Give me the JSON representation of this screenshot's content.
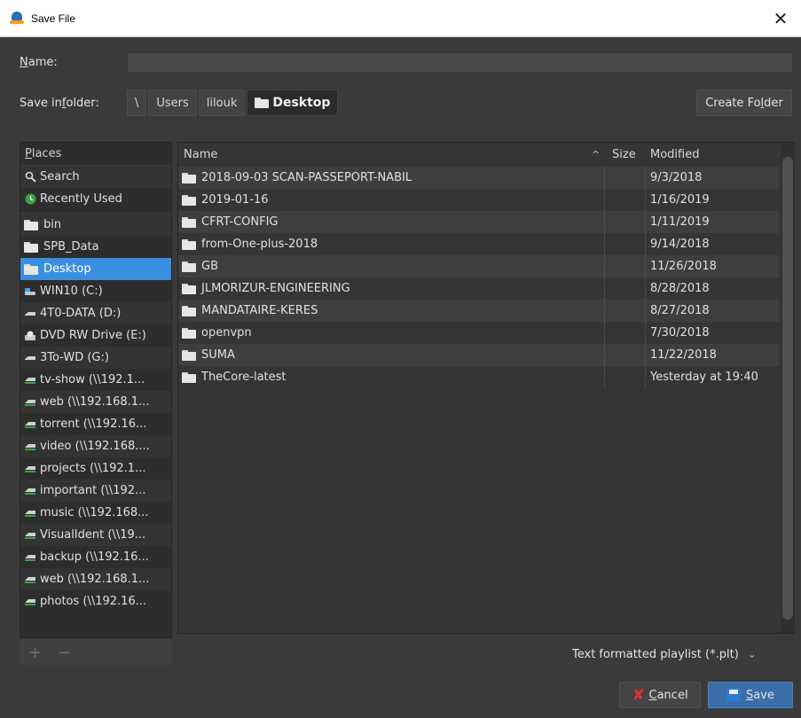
{
  "window": {
    "title": "Save File",
    "close_glyph": "✕"
  },
  "name_row": {
    "label_u": "N",
    "label_rest": "ame:",
    "value": ""
  },
  "folder_row": {
    "label_pre": "Save in ",
    "label_u": "f",
    "label_post": "older:",
    "crumbs": [
      "\\",
      "Users",
      "lilouk",
      "Desktop"
    ]
  },
  "create_folder": {
    "pre": "Create Fo",
    "u": "l",
    "post": "der"
  },
  "places": {
    "header_u": "P",
    "header_rest": "laces",
    "items": [
      {
        "label": "Search",
        "icon": "search-icon"
      },
      {
        "label": "Recently Used",
        "icon": "recent-icon"
      },
      {
        "label": "bin",
        "icon": "folder-icon"
      },
      {
        "label": "SPB_Data",
        "icon": "folder-icon"
      },
      {
        "label": "Desktop",
        "icon": "folder-icon"
      },
      {
        "label": "WIN10 (C:)",
        "icon": "drive-icon"
      },
      {
        "label": "4T0-DATA (D:)",
        "icon": "drive-icon"
      },
      {
        "label": "DVD RW Drive (E:)",
        "icon": "disc-icon"
      },
      {
        "label": "3To-WD (G:)",
        "icon": "drive-icon"
      },
      {
        "label": "tv-show (\\\\192.1...",
        "icon": "network-drive-icon"
      },
      {
        "label": "web (\\\\192.168.1...",
        "icon": "network-drive-icon"
      },
      {
        "label": "torrent (\\\\192.16...",
        "icon": "network-drive-icon"
      },
      {
        "label": "video (\\\\192.168....",
        "icon": "network-drive-icon"
      },
      {
        "label": "projects (\\\\192.1...",
        "icon": "network-drive-icon"
      },
      {
        "label": "important (\\\\192...",
        "icon": "network-drive-icon"
      },
      {
        "label": "music (\\\\192.168...",
        "icon": "network-drive-icon"
      },
      {
        "label": "VisualIdent (\\\\19...",
        "icon": "network-drive-icon"
      },
      {
        "label": "backup (\\\\192.16...",
        "icon": "network-drive-icon"
      },
      {
        "label": "web (\\\\192.168.1...",
        "icon": "network-drive-icon"
      },
      {
        "label": "photos (\\\\192.16...",
        "icon": "network-drive-icon"
      }
    ],
    "footer_add": "+",
    "footer_remove": "−"
  },
  "files": {
    "columns": {
      "name": "Name",
      "sort_glyph": "^",
      "size": "Size",
      "modified": "Modified"
    },
    "rows": [
      {
        "name": "2018-09-03 SCAN-PASSEPORT-NABIL",
        "modified": "9/3/2018"
      },
      {
        "name": "2019-01-16",
        "modified": "1/16/2019"
      },
      {
        "name": "CFRT-CONFIG",
        "modified": "1/11/2019"
      },
      {
        "name": "from-One-plus-2018",
        "modified": "9/14/2018"
      },
      {
        "name": "GB",
        "modified": "11/26/2018"
      },
      {
        "name": "JLMORIZUR-ENGINEERING",
        "modified": "8/28/2018"
      },
      {
        "name": "MANDATAIRE-KERES",
        "modified": "8/27/2018"
      },
      {
        "name": "openvpn",
        "modified": "7/30/2018"
      },
      {
        "name": "SUMA",
        "modified": "11/22/2018"
      },
      {
        "name": "TheCore-latest",
        "modified": "Yesterday at 19:40"
      }
    ]
  },
  "filter": {
    "value": "Text formatted playlist (*.plt)",
    "caret": "⌄"
  },
  "buttons": {
    "cancel_u": "C",
    "cancel_rest": "ancel",
    "save_u": "S",
    "save_rest": "ave"
  }
}
